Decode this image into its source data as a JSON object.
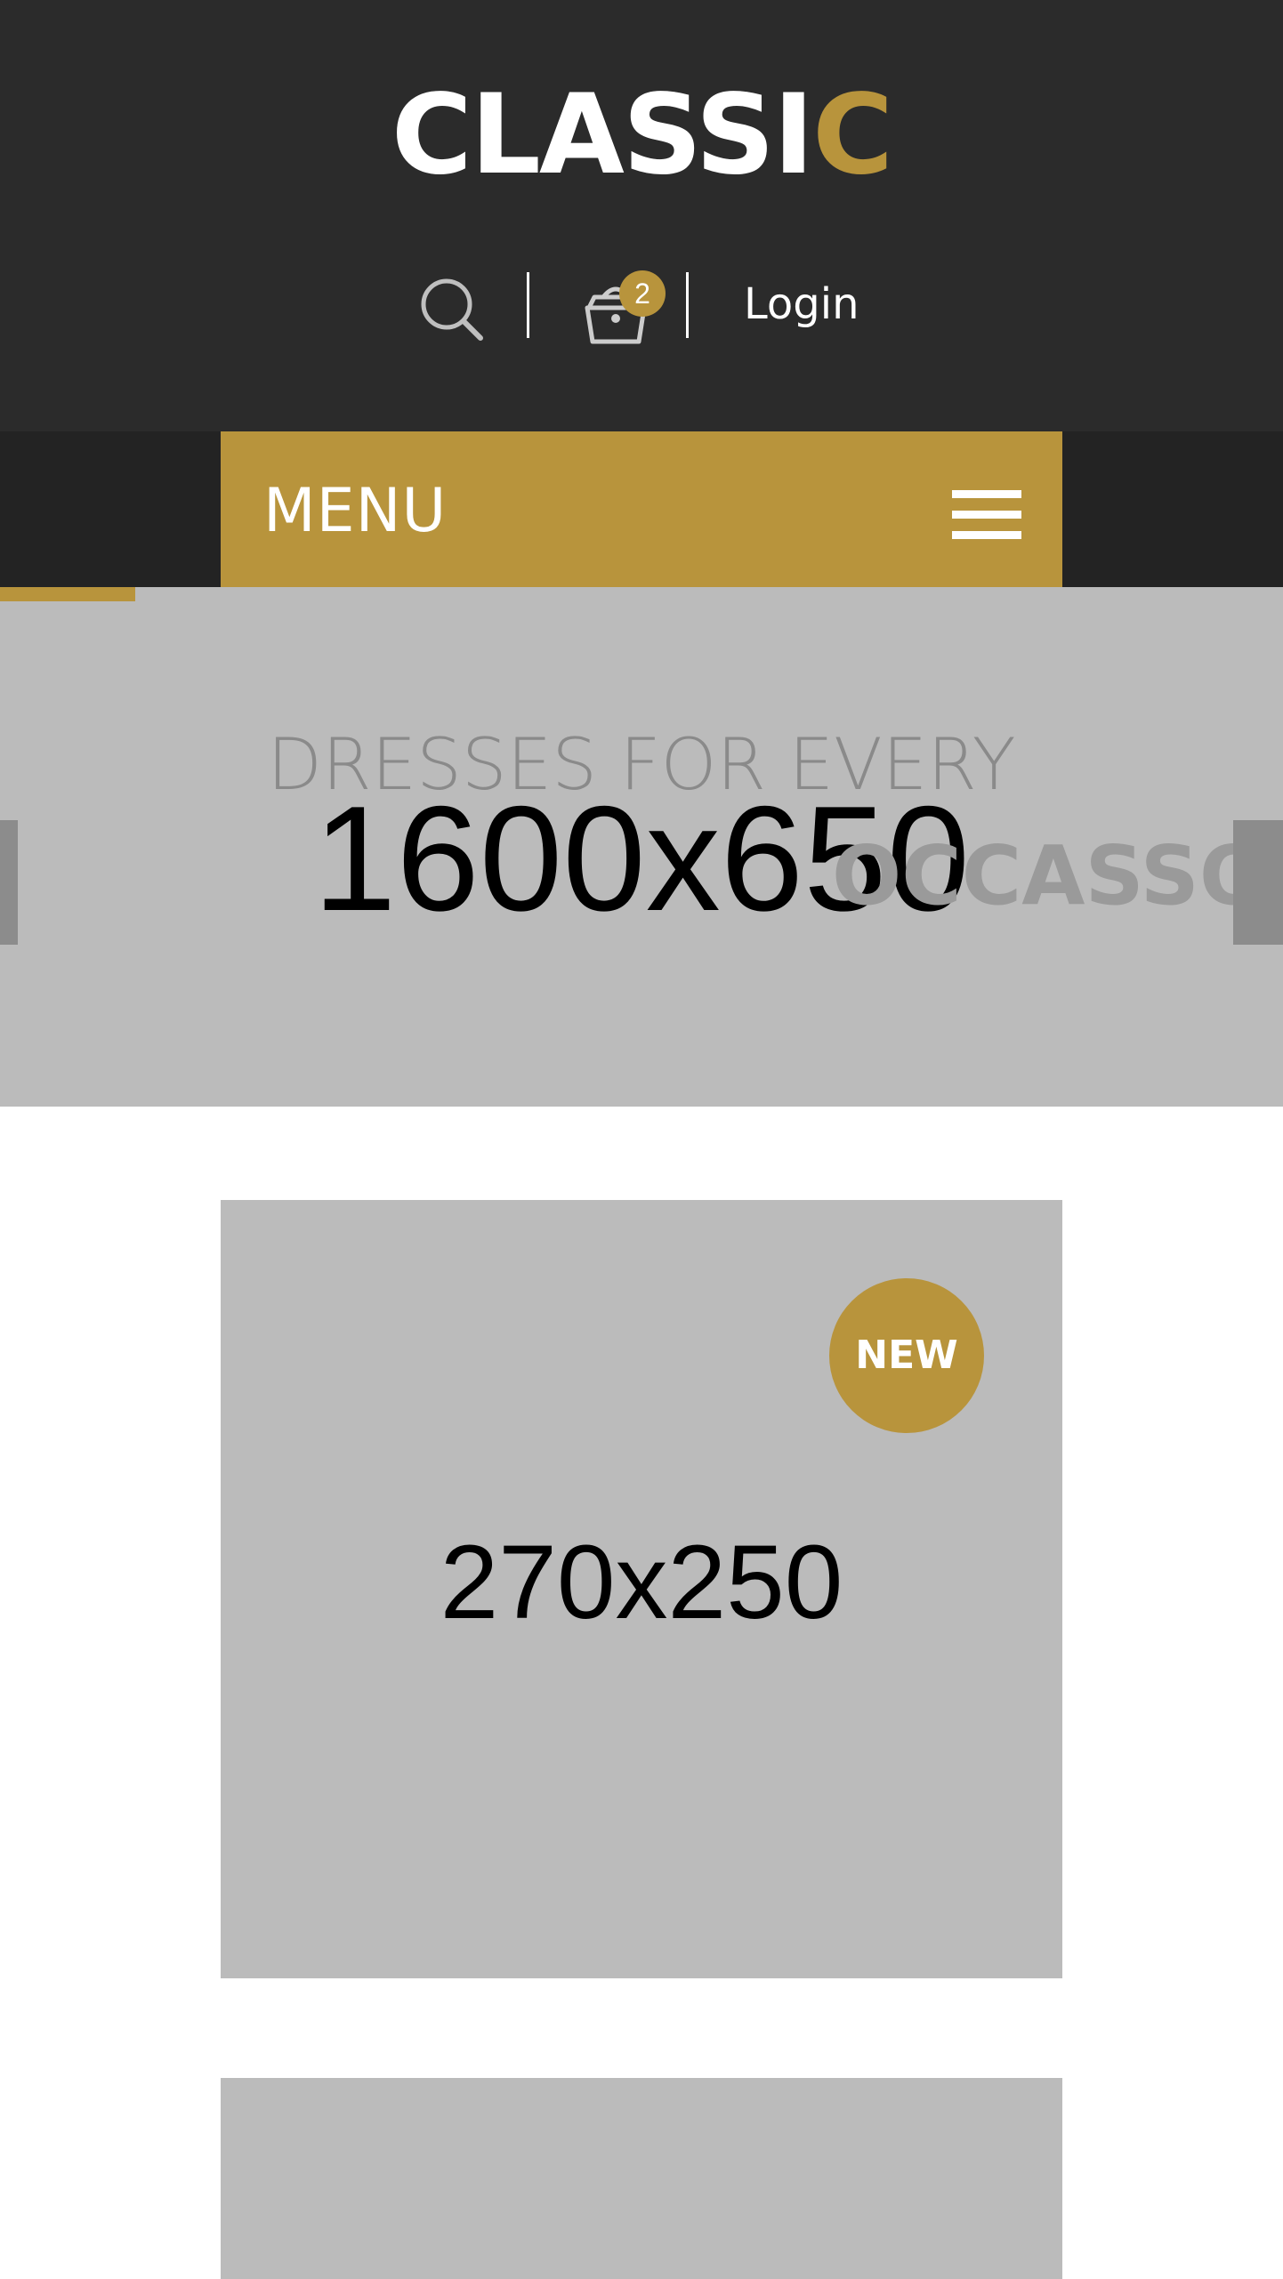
{
  "header": {
    "logo_main": "CLASSI",
    "logo_accent": "C",
    "cart_count": "2",
    "login_label": "Login"
  },
  "menu": {
    "label": "MENU"
  },
  "slider": {
    "caption": "DRESSES FOR EVERY",
    "subcaption": "OCCASSON",
    "placeholder": "1600x650"
  },
  "products": [
    {
      "placeholder": "270x250",
      "badge": "NEW"
    },
    {
      "placeholder": ""
    }
  ],
  "colors": {
    "header_bg": "#2b2b2b",
    "accent": "#b8943c",
    "placeholder_bg": "#bbbbbb"
  },
  "icons": {
    "search": "search-icon",
    "cart": "cart-icon",
    "menu": "hamburger-icon"
  }
}
